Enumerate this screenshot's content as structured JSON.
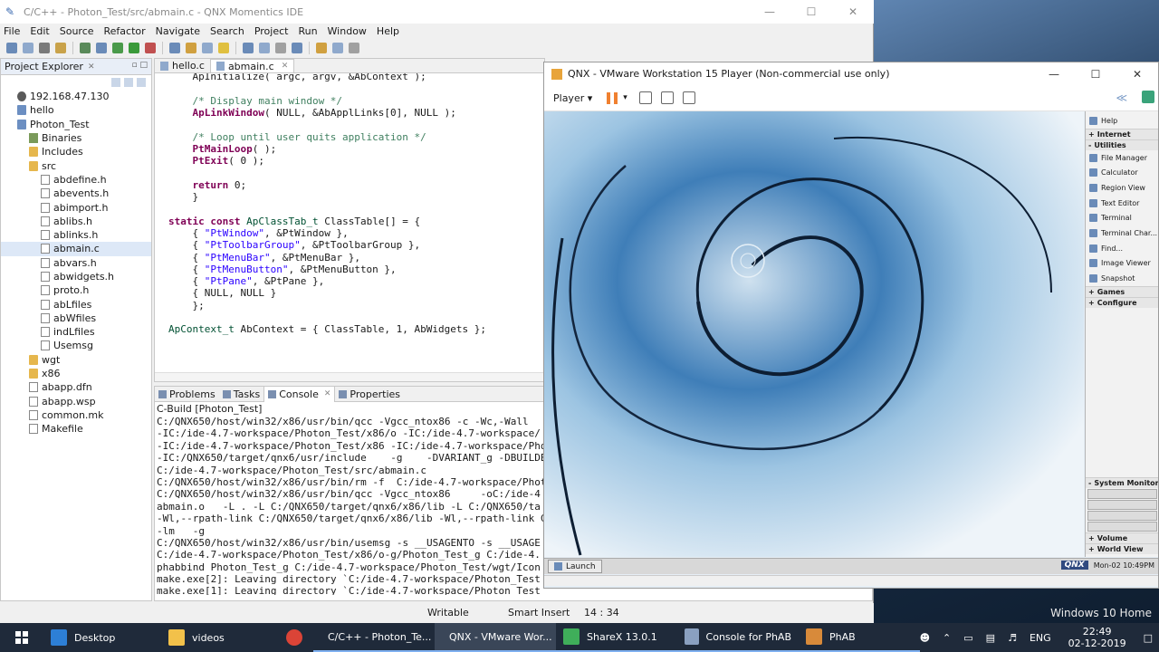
{
  "ide": {
    "title": "C/C++ - Photon_Test/src/abmain.c - QNX Momentics IDE",
    "menu": [
      "File",
      "Edit",
      "Source",
      "Refactor",
      "Navigate",
      "Search",
      "Project",
      "Run",
      "Window",
      "Help"
    ],
    "explorer": {
      "tab_label": "Project Explorer",
      "items": [
        {
          "label": "192.168.47.130",
          "indent": 1,
          "icon": "target"
        },
        {
          "label": "hello",
          "indent": 1,
          "icon": "project"
        },
        {
          "label": "Photon_Test",
          "indent": 1,
          "icon": "project"
        },
        {
          "label": "Binaries",
          "indent": 2,
          "icon": "bin"
        },
        {
          "label": "Includes",
          "indent": 2,
          "icon": "folder"
        },
        {
          "label": "src",
          "indent": 2,
          "icon": "folder"
        },
        {
          "label": "abdefine.h",
          "indent": 3,
          "icon": "file"
        },
        {
          "label": "abevents.h",
          "indent": 3,
          "icon": "file"
        },
        {
          "label": "abimport.h",
          "indent": 3,
          "icon": "file"
        },
        {
          "label": "ablibs.h",
          "indent": 3,
          "icon": "file"
        },
        {
          "label": "ablinks.h",
          "indent": 3,
          "icon": "file"
        },
        {
          "label": "abmain.c",
          "indent": 3,
          "icon": "file",
          "selected": true
        },
        {
          "label": "abvars.h",
          "indent": 3,
          "icon": "file"
        },
        {
          "label": "abwidgets.h",
          "indent": 3,
          "icon": "file"
        },
        {
          "label": "proto.h",
          "indent": 3,
          "icon": "file"
        },
        {
          "label": "abLfiles",
          "indent": 3,
          "icon": "file"
        },
        {
          "label": "abWfiles",
          "indent": 3,
          "icon": "file"
        },
        {
          "label": "indLfiles",
          "indent": 3,
          "icon": "file"
        },
        {
          "label": "Usemsg",
          "indent": 3,
          "icon": "file"
        },
        {
          "label": "wgt",
          "indent": 2,
          "icon": "folder"
        },
        {
          "label": "x86",
          "indent": 2,
          "icon": "folder"
        },
        {
          "label": "abapp.dfn",
          "indent": 2,
          "icon": "file"
        },
        {
          "label": "abapp.wsp",
          "indent": 2,
          "icon": "file"
        },
        {
          "label": "common.mk",
          "indent": 2,
          "icon": "file"
        },
        {
          "label": "Makefile",
          "indent": 2,
          "icon": "file"
        }
      ]
    },
    "editor": {
      "tabs": [
        "hello.c",
        "abmain.c"
      ],
      "code_lines": [
        {
          "parts": [
            {
              "t": "    ApInitialize( argc, argv, &AbContext );",
              "c": ""
            }
          ]
        },
        {
          "parts": [
            {
              "t": "",
              "c": ""
            }
          ]
        },
        {
          "parts": [
            {
              "t": "    /* Display main window */",
              "c": "cm"
            }
          ]
        },
        {
          "parts": [
            {
              "t": "    ApLinkWindow",
              "c": "kw"
            },
            {
              "t": "( NULL, &AbApplLinks[0], NULL );",
              "c": ""
            }
          ]
        },
        {
          "parts": [
            {
              "t": "",
              "c": ""
            }
          ]
        },
        {
          "parts": [
            {
              "t": "    /* Loop until user quits application */",
              "c": "cm"
            }
          ]
        },
        {
          "parts": [
            {
              "t": "    PtMainLoop",
              "c": "kw"
            },
            {
              "t": "( );",
              "c": ""
            }
          ]
        },
        {
          "parts": [
            {
              "t": "    PtExit",
              "c": "kw"
            },
            {
              "t": "( 0 );",
              "c": ""
            }
          ]
        },
        {
          "parts": [
            {
              "t": "",
              "c": ""
            }
          ]
        },
        {
          "parts": [
            {
              "t": "    return",
              "c": "kw"
            },
            {
              "t": " 0;",
              "c": ""
            }
          ]
        },
        {
          "parts": [
            {
              "t": "    }",
              "c": ""
            }
          ]
        },
        {
          "parts": [
            {
              "t": "",
              "c": ""
            }
          ]
        },
        {
          "parts": [
            {
              "t": "static const",
              "c": "kw"
            },
            {
              "t": " ",
              "c": ""
            },
            {
              "t": "ApClassTab_t",
              "c": "ty"
            },
            {
              "t": " ClassTable[] = {",
              "c": ""
            }
          ]
        },
        {
          "parts": [
            {
              "t": "    { ",
              "c": ""
            },
            {
              "t": "\"PtWindow\"",
              "c": "st"
            },
            {
              "t": ", &PtWindow },",
              "c": ""
            }
          ]
        },
        {
          "parts": [
            {
              "t": "    { ",
              "c": ""
            },
            {
              "t": "\"PtToolbarGroup\"",
              "c": "st"
            },
            {
              "t": ", &PtToolbarGroup },",
              "c": ""
            }
          ]
        },
        {
          "parts": [
            {
              "t": "    { ",
              "c": ""
            },
            {
              "t": "\"PtMenuBar\"",
              "c": "st"
            },
            {
              "t": ", &PtMenuBar },",
              "c": ""
            }
          ]
        },
        {
          "parts": [
            {
              "t": "    { ",
              "c": ""
            },
            {
              "t": "\"PtMenuButton\"",
              "c": "st"
            },
            {
              "t": ", &PtMenuButton },",
              "c": ""
            }
          ]
        },
        {
          "parts": [
            {
              "t": "    { ",
              "c": ""
            },
            {
              "t": "\"PtPane\"",
              "c": "st"
            },
            {
              "t": ", &PtPane },",
              "c": ""
            }
          ]
        },
        {
          "parts": [
            {
              "t": "    { NULL, NULL }",
              "c": ""
            }
          ]
        },
        {
          "parts": [
            {
              "t": "    };",
              "c": ""
            }
          ]
        },
        {
          "parts": [
            {
              "t": "",
              "c": ""
            }
          ]
        },
        {
          "parts": [
            {
              "t": "ApContext_t",
              "c": "ty"
            },
            {
              "t": " AbContext = { ClassTable, 1, AbWidgets };",
              "c": ""
            }
          ]
        }
      ]
    },
    "console": {
      "tabs": [
        "Problems",
        "Tasks",
        "Console",
        "Properties"
      ],
      "label": "C-Build [Photon_Test]",
      "lines": [
        "C:/QNX650/host/win32/x86/usr/bin/qcc -Vgcc_ntox86 -c -Wc,-Wall",
        "-IC:/ide-4.7-workspace/Photon_Test/x86/o -IC:/ide-4.7-workspace/",
        "-IC:/ide-4.7-workspace/Photon_Test/x86 -IC:/ide-4.7-workspace/Pho",
        "-IC:/QNX650/target/qnx6/usr/include    -g    -DVARIANT_g -DBUILDE",
        "C:/ide-4.7-workspace/Photon_Test/src/abmain.c",
        "C:/QNX650/host/win32/x86/usr/bin/rm -f  C:/ide-4.7-workspace/Phot",
        "C:/QNX650/host/win32/x86/usr/bin/qcc -Vgcc_ntox86     -oC:/ide-4",
        "abmain.o   -L . -L C:/QNX650/target/qnx6/x86/lib -L C:/QNX650/ta",
        "-Wl,--rpath-link C:/QNX650/target/qnx6/x86/lib -Wl,--rpath-link C",
        "-lm   -g",
        "C:/QNX650/host/win32/x86/usr/bin/usemsg -s __USAGENTO -s __USAGE",
        "C:/ide-4.7-workspace/Photon_Test/x86/o-g/Photon_Test_g C:/ide-4.",
        "phabbind Photon_Test_g C:/ide-4.7-workspace/Photon_Test/wgt/Icon",
        "make.exe[2]: Leaving directory `C:/ide-4.7-workspace/Photon_Test",
        "make.exe[1]: Leaving directory `C:/ide-4.7-workspace/Photon_Test"
      ]
    },
    "status": {
      "mode": "Writable",
      "insert": "Smart Insert",
      "position": "14 : 34"
    }
  },
  "vm": {
    "title": "QNX - VMware Workstation 15 Player (Non-commercial use only)",
    "player_label": "Player",
    "shelf": [
      {
        "type": "item",
        "label": "Help"
      },
      {
        "type": "head",
        "label": "Internet",
        "sign": "+"
      },
      {
        "type": "head",
        "label": "Utilities",
        "sign": "-"
      },
      {
        "type": "item",
        "label": "File Manager"
      },
      {
        "type": "item",
        "label": "Calculator"
      },
      {
        "type": "item",
        "label": "Region View"
      },
      {
        "type": "item",
        "label": "Text Editor"
      },
      {
        "type": "item",
        "label": "Terminal"
      },
      {
        "type": "item",
        "label": "Terminal Char..."
      },
      {
        "type": "item",
        "label": "Find..."
      },
      {
        "type": "item",
        "label": "Image Viewer"
      },
      {
        "type": "item",
        "label": "Snapshot"
      },
      {
        "type": "head",
        "label": "Games",
        "sign": "+"
      },
      {
        "type": "head",
        "label": "Configure",
        "sign": "+"
      }
    ],
    "sysmon_label": "System Monitor",
    "volume_label": "Volume",
    "worldview_label": "World View",
    "launch_label": "Launch",
    "qnx_logo": "QNX",
    "guest_clock": "Mon-02 10:49PM"
  },
  "desktop": {
    "watermark": "Windows 10 Home"
  },
  "taskbar": {
    "apps": [
      {
        "label": "Desktop",
        "color": "#2d7fd6",
        "state": ""
      },
      {
        "label": "videos",
        "color": "#f2c14a",
        "state": ""
      },
      {
        "label": "",
        "color": "#db4437",
        "state": ""
      },
      {
        "label": "C/C++ - Photon_Te...",
        "color": "#5a7ab5",
        "state": "open"
      },
      {
        "label": "QNX - VMware Wor...",
        "color": "#e8a43a",
        "state": "active"
      },
      {
        "label": "ShareX 13.0.1",
        "color": "#3fae5a",
        "state": "open"
      },
      {
        "label": "Console for PhAB",
        "color": "#8aa0c0",
        "state": "open"
      },
      {
        "label": "PhAB",
        "color": "#d88a3a",
        "state": "open"
      }
    ],
    "tray_lang": "ENG",
    "time": "22:49",
    "date": "02-12-2019"
  }
}
